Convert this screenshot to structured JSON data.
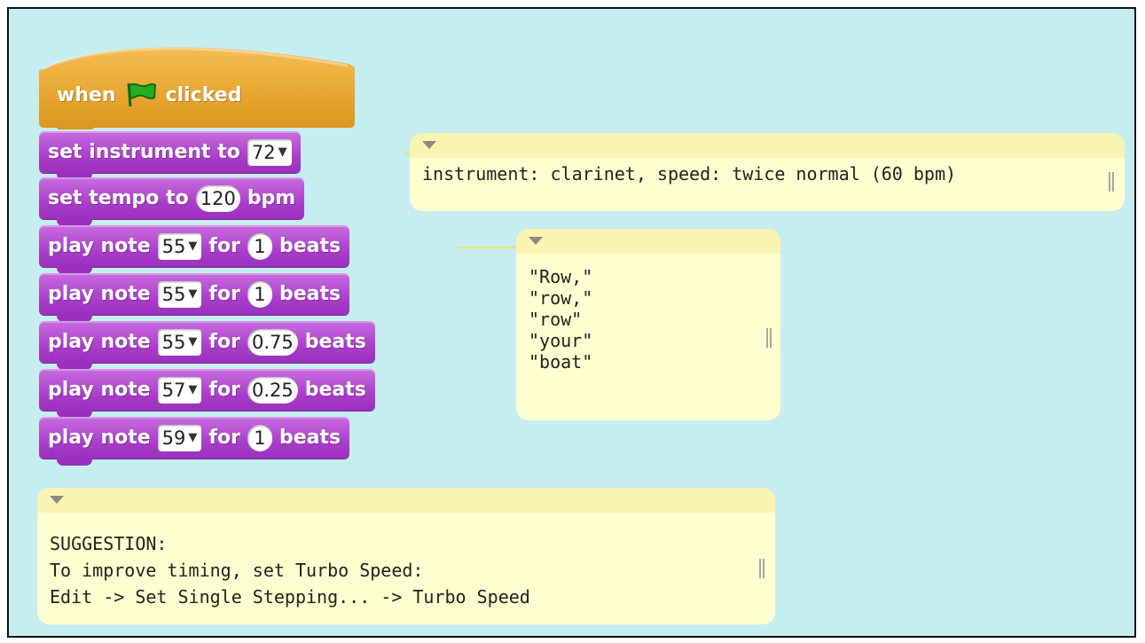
{
  "script": {
    "hat": {
      "word1": "when",
      "word2": "clicked",
      "flag_icon": "green-flag-icon"
    },
    "set_instrument": {
      "label": "set instrument to",
      "value": "72"
    },
    "set_tempo": {
      "label": "set tempo to",
      "value": "120",
      "unit": "bpm"
    },
    "play_notes": [
      {
        "label": "play note",
        "note": "55",
        "for": "for",
        "beats": "1",
        "unit": "beats"
      },
      {
        "label": "play note",
        "note": "55",
        "for": "for",
        "beats": "1",
        "unit": "beats"
      },
      {
        "label": "play note",
        "note": "55",
        "for": "for",
        "beats": "0.75",
        "unit": "beats"
      },
      {
        "label": "play note",
        "note": "57",
        "for": "for",
        "beats": "0.25",
        "unit": "beats"
      },
      {
        "label": "play note",
        "note": "59",
        "for": "for",
        "beats": "1",
        "unit": "beats"
      }
    ]
  },
  "comments": {
    "instrument": {
      "text": "instrument: clarinet, speed: twice normal (60 bpm)"
    },
    "lyrics": {
      "lines": [
        "\"Row,\"",
        "\"row,\"",
        "\"row\"",
        "\"your\"",
        "\"boat\""
      ]
    },
    "suggestion": {
      "lines": [
        "SUGGESTION:",
        "To improve timing, set Turbo Speed:",
        "Edit -> Set Single Stepping... -> Turbo Speed"
      ]
    }
  },
  "colors": {
    "canvas": "#c6eef0",
    "hat_block": "#e6a42e",
    "sound_block": "#a83cc8",
    "comment_body": "#fefed0",
    "comment_header": "#fbf3b2",
    "flag": "#22b022"
  }
}
